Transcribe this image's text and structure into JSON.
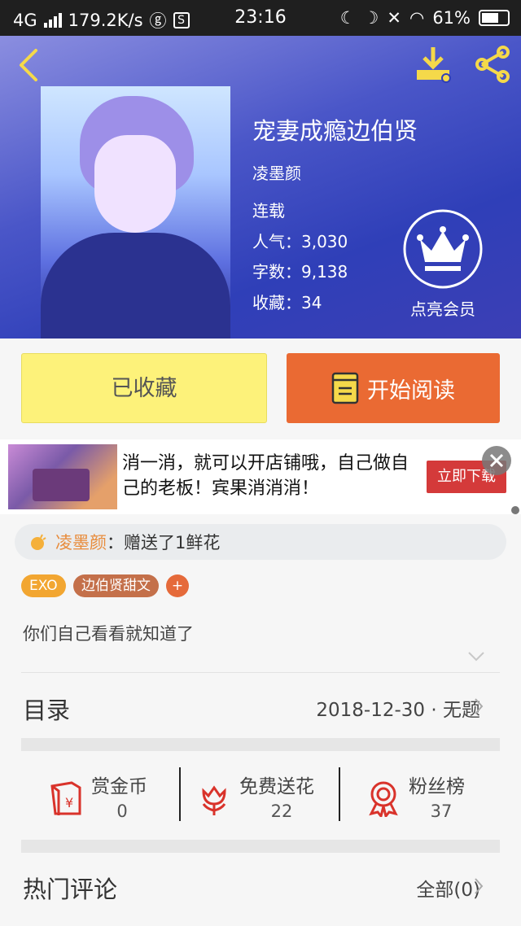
{
  "status": {
    "network": "4G",
    "speed": "179.2K/s",
    "time": "23:16",
    "battery": "61%"
  },
  "book": {
    "title": "宠妻成瘾边伯贤",
    "author": "凌墨颜",
    "state": "连载",
    "popularity": "人气：3,030",
    "words": "字数：9,138",
    "favorites": "收藏：34"
  },
  "vip": {
    "label": "点亮会员"
  },
  "actions": {
    "favorited": "已收藏",
    "read": "开始阅读"
  },
  "ad": {
    "text": "消一消，就可以开店铺哦，自己做自己的老板！宾果消消消！",
    "cta": "立即下载"
  },
  "gift": {
    "name": "凌墨颜",
    "message": "：赠送了1鲜花"
  },
  "tags": [
    "EXO",
    "边伯贤甜文",
    "+"
  ],
  "intro": "你们自己看看就知道了",
  "catalog": {
    "label": "目录",
    "info": "2018-12-30 · 无题"
  },
  "stats": [
    {
      "label": "赏金币",
      "value": "0"
    },
    {
      "label": "免费送花",
      "value": "22"
    },
    {
      "label": "粉丝榜",
      "value": "37"
    }
  ],
  "comments": {
    "label": "热门评论",
    "all": "全部(0)"
  },
  "colors": {
    "accent": "#ea6a33",
    "fav": "#fdf27a",
    "icon_yellow": "#f5d94a",
    "icon_red": "#d9332b"
  }
}
